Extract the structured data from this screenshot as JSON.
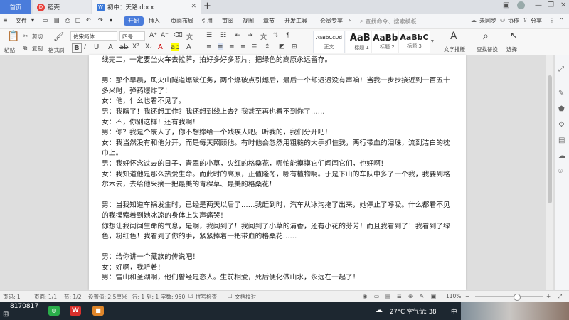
{
  "tabs": {
    "home": "首页",
    "daoke": "稻壳",
    "document": "初中：天路.docx"
  },
  "menu": {
    "file": "文件",
    "items": [
      "开始",
      "插入",
      "页面布局",
      "引用",
      "审阅",
      "视图",
      "章节",
      "开发工具",
      "会员专享"
    ],
    "search_placeholder": "查找命令、搜索模板",
    "not_synced": "未同步",
    "collaborate": "协作",
    "share": "分享"
  },
  "ribbon": {
    "paste": "粘贴",
    "cut": "剪切",
    "copy": "复制",
    "format_painter": "格式刷",
    "font_name": "仿宋简体",
    "font_size": "四号",
    "styles": [
      {
        "sample": "AaBbCcDd",
        "name": "正文"
      },
      {
        "sample": "AaBl",
        "name": "标题 1"
      },
      {
        "sample": "AaBb(",
        "name": "标题 2"
      },
      {
        "sample": "AaBbC",
        "name": "标题 3"
      }
    ],
    "text_layout": "文字排版",
    "find_replace": "查找替换",
    "select": "选择"
  },
  "document": {
    "lines": [
      "线完工，一定要坐火车去拉萨，拍好多好多照片，把绿色的高原永远留存。",
      "",
      "男：那个早晨，风火山隧道爆破任务，两个爆破点引爆后，最后一个却迟迟没有声响！当我一步步接近到一百五十多米时，弹药爆炸了！",
      "女：他，什么也看不见了。",
      "男：我瞎了！我还想工作？我还想到线上去？我甚至再也看不到你了……",
      "女：不，你别这样！还有我啊！",
      "男：你？我是个废人了，你不想嫁给一个残疾人吧。听我的，我们分开吧！",
      "女：我当然没有和他分开，而是每天照顾他。有时他会忽然用粗糙的大手抓住我，两行带血的泪珠，流到洁白的枕巾上。",
      "男：我好怀念过去的日子，青翠的小草，火红的格桑花，哪怕能摸摸它们闻闻它们，也好啊！",
      "女：我知道他是那么热爱生命。而此时的高原，正值隆冬，哪有植物啊。于是下山的车队中多了一个我，我要到格尔木去，去给他采摘一把最美的青稞草、最美的格桑花！",
      "",
      "男：当我知道车祸发生时，已经是两天以后了……我赶到时，汽车从冰沟拖了出来，她停止了呼吸。什么都看不见的我摸索着到她冰凉的身体上失声痛哭！",
      "你想让我闻闻生命的气息，是啊，我闻到了！我闻到了小草的清香，还有小花的芬芳！而且我看到了！我看到了绿色，粉红色！我看到了你的手，紧紧捧着一把带血的格桑花……",
      "",
      "男：给你讲一个藏族的传说吧！",
      "女：好啊，我听着！",
      "男：雪山和圣湖啊，他们曾经是恋人。生前相爱，死后便化做山水，永远在一起了！"
    ]
  },
  "status": {
    "page": "页码: 1",
    "pages": "页面: 1/1",
    "section": "节: 1/2",
    "position": "设置值: 2.5厘米",
    "row": "行: 1",
    "col": "列: 1",
    "words": "字数: 950",
    "spellcheck": "拼写检查",
    "doc_check": "文档校对",
    "zoom": "110%"
  },
  "taskbar": {
    "left_id": "8170817",
    "weather": "27°C 空气优: 38",
    "ime": "中"
  }
}
